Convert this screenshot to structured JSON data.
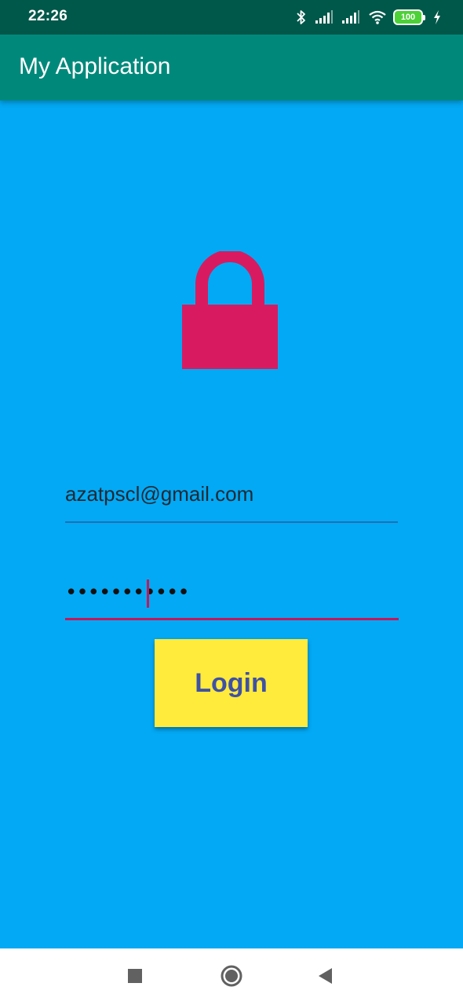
{
  "status_bar": {
    "time": "22:26",
    "battery_level": "100",
    "icons": [
      "bluetooth-icon",
      "signal-icon",
      "signal-icon",
      "wifi-icon",
      "battery-icon",
      "charging-icon"
    ]
  },
  "app_bar": {
    "title": "My Application",
    "color": "#00897B"
  },
  "login_form": {
    "lock_icon": "lock-icon",
    "lock_color": "#D81B60",
    "email_value": "azatpscl@gmail.com",
    "password_masked": "•••••••••••",
    "login_label": "Login",
    "button_color": "#FFEB3B",
    "background_color": "#03A9F4"
  },
  "nav_bar": {
    "buttons": [
      "recents-icon",
      "home-icon",
      "back-icon"
    ]
  }
}
